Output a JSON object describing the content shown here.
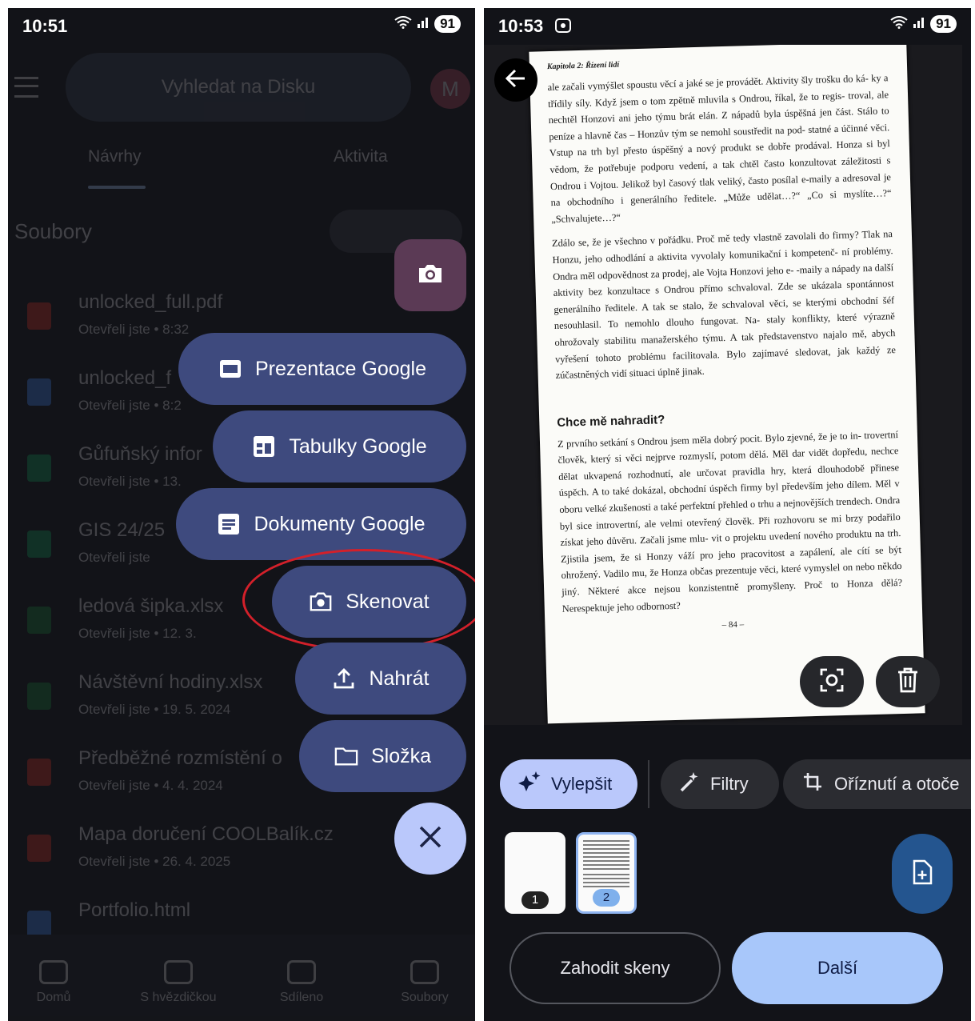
{
  "left": {
    "status": {
      "time": "10:51",
      "battery": "91"
    },
    "search_placeholder": "Vyhledat na Disku",
    "avatar_letter": "M",
    "tabs": [
      "Návrhy",
      "Aktivita"
    ],
    "section_title": "Soubory",
    "files": [
      {
        "name": "unlocked_full.pdf",
        "meta": "Otevřeli jste • 8:32",
        "color": "#d93025"
      },
      {
        "name": "unlocked_f",
        "meta": "Otevřeli jste • 8:2",
        "color": "#4285f4"
      },
      {
        "name": "Gůfuňský infor",
        "meta": "Otevřeli jste • 13.",
        "color": "#0f9d58"
      },
      {
        "name": "GIS 24/25",
        "meta": "Otevřeli jste",
        "color": "#0f9d58"
      },
      {
        "name": "ledová šipka.xlsx",
        "meta": "Otevřeli jste • 12. 3.",
        "color": "#188038"
      },
      {
        "name": "Návštěvní hodiny.xlsx",
        "meta": "Otevřeli jste • 19. 5. 2024",
        "color": "#188038"
      },
      {
        "name": "Předběžné rozmístění o",
        "meta": "Otevřeli jste • 4. 4. 2024",
        "color": "#d93025"
      },
      {
        "name": "Mapa doručení COOLBalík.cz",
        "meta": "Otevřeli jste • 26. 4. 2025",
        "color": "#d93025"
      },
      {
        "name": "Portfolio.html",
        "meta": "",
        "color": "#4285f4"
      }
    ],
    "speed_dial": {
      "presentation": "Prezentace Google",
      "sheets": "Tabulky Google",
      "docs": "Dokumenty Google",
      "scan": "Skenovat",
      "upload": "Nahrát",
      "folder": "Složka"
    },
    "nav": [
      "Domů",
      "S hvězdičkou",
      "Sdíleno",
      "Soubory"
    ],
    "highlight_color": "#d3202a"
  },
  "right": {
    "status": {
      "time": "10:53",
      "battery": "91"
    },
    "document": {
      "chapter": "Kapitola 2: Řízení lidí",
      "paragraphs": [
        "ale začali vymýšlet spoustu věcí a jaké se je provádět. Aktivity šly trošku do ká- ky a třídily síly. Když jsem o tom zpětně mluvila s Ondrou, říkal, že to regis- troval, ale nechtěl Honzovi ani jeho týmu brát elán. Z nápadů byla úspěšná jen část. Stálo to peníze a hlavně čas – Honzův tým se nemohl soustředit na pod- statné a účinné věci. Vstup na trh byl přesto úspěšný a nový produkt se dobře prodával. Honza si byl vědom, že potřebuje podporu vedení, a tak chtěl často konzultovat záležitosti s Ondrou i Vojtou. Jelikož byl časový tlak veliký, často posílal e-maily a adresoval je na obchodního i generálního ředitele. „Může udělat…?“ „Co si myslíte…?“ „Schvalujete…?“",
        "Zdálo se, že je všechno v pořádku. Proč mě tedy vlastně zavolali do firmy? Tlak na Honzu, jeho odhodlání a aktivita vyvolaly komunikační i kompetenč- ní problémy. Ondra měl odpovědnost za prodej, ale Vojta Honzovi jeho e- -maily a nápady na další aktivity bez konzultace s Ondrou přímo schvaloval. Zde se ukázala spontánnost generálního ředitele. A tak se stalo, že schvaloval věci, se kterými obchodní šéf nesouhlasil. To nemohlo dlouho fungovat. Na- staly konflikty, které výrazně ohrožovaly stabilitu manažerského týmu. A tak představenstvo najalo mě, abych vyřešení tohoto problému facilitovala. Bylo zajímavé sledovat, jak každý ze zúčastněných vidí situaci úplně jinak."
      ],
      "heading": "Chce mě nahradit?",
      "paragraph3": "Z prvního setkání s Ondrou jsem měla dobrý pocit. Bylo zjevné, že je to in- trovertní člověk, který si věci nejprve rozmyslí, potom dělá. Měl dar vidět dopředu, nechce dělat ukvapená rozhodnutí, ale určovat pravidla hry, která dlouhodobě přinese úspěch. A to také dokázal, obchodní úspěch firmy byl především jeho dílem. Měl v oboru velké zkušenosti a také perfektní přehled o trhu a nejnovějších trendech. Ondra byl sice introvertní, ale velmi otevřený člověk. Při rozhovoru se mi brzy podařilo získat jeho důvěru. Začali jsme mlu- vit o projektu uvedení nového produktu na trh. Zjistila jsem, že si Honzy váží pro jeho pracovitost a zapálení, ale cítí se být ohrožený. Vadilo mu, že Honza občas prezentuje věci, které vymyslel on nebo někdo jiný. Některé akce nejsou konzistentně promyšleny. Proč to Honza dělá? Nerespektuje jeho odbornost?",
      "page_number": "– 84 –"
    },
    "chips": {
      "enhance": "Vylepšit",
      "filters": "Filtry",
      "crop": "Oříznutí a otoče"
    },
    "thumbnails": [
      "1",
      "2"
    ],
    "buttons": {
      "discard": "Zahodit skeny",
      "next": "Další"
    }
  }
}
